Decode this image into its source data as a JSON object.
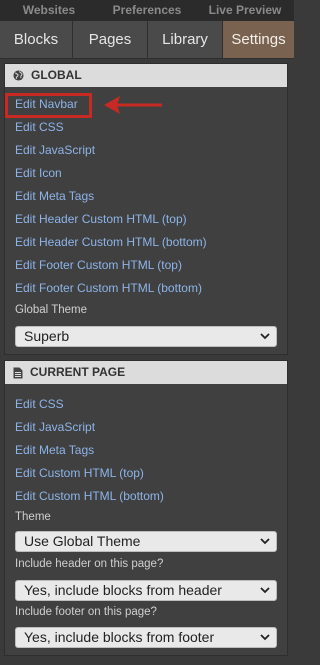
{
  "topnav": {
    "items": [
      "Websites",
      "Preferences",
      "Live Preview"
    ]
  },
  "tabs": [
    "Blocks",
    "Pages",
    "Library",
    "Settings"
  ],
  "active_tab": "Settings",
  "global": {
    "title": "GLOBAL",
    "icon": "globe-icon",
    "links": [
      "Edit Navbar",
      "Edit CSS",
      "Edit JavaScript",
      "Edit Icon",
      "Edit Meta Tags",
      "Edit Header Custom HTML (top)",
      "Edit Header Custom HTML (bottom)",
      "Edit Footer Custom HTML (top)",
      "Edit Footer Custom HTML (bottom)"
    ],
    "theme_label": "Global Theme",
    "theme_value": "Superb"
  },
  "current_page": {
    "title": "CURRENT PAGE",
    "icon": "document-icon",
    "links": [
      "Edit CSS",
      "Edit JavaScript",
      "Edit Meta Tags",
      "Edit Custom HTML (top)",
      "Edit Custom HTML (bottom)"
    ],
    "theme_label": "Theme",
    "theme_value": "Use Global Theme",
    "header_label": "Include header on this page?",
    "header_value": "Yes, include blocks from header",
    "footer_label": "Include footer on this page?",
    "footer_value": "Yes, include blocks from footer"
  },
  "annotation": {
    "color": "#c62a22",
    "target": "Edit Navbar"
  }
}
